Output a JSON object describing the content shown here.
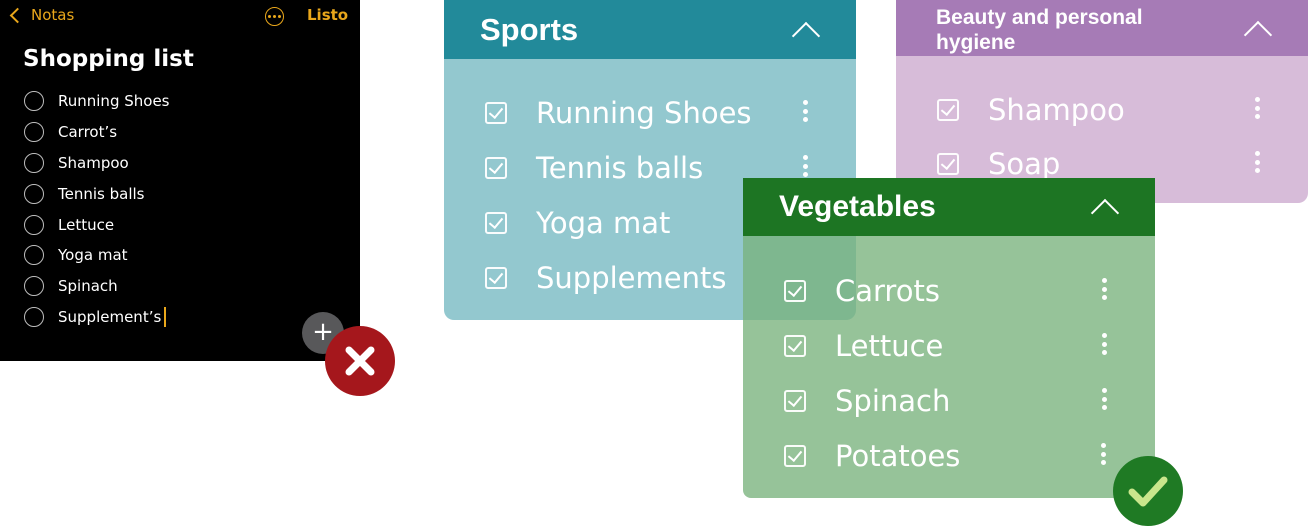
{
  "notes_app": {
    "back_label": "Notas",
    "done_label": "Listo",
    "title": "Shopping list",
    "items": [
      {
        "label": "Running Shoes"
      },
      {
        "label": "Carrot’s"
      },
      {
        "label": "Shampoo"
      },
      {
        "label": "Tennis balls"
      },
      {
        "label": "Lettuce"
      },
      {
        "label": "Yoga mat"
      },
      {
        "label": "Spinach"
      },
      {
        "label": "Supplement’s"
      }
    ],
    "add_icon": "plus-icon",
    "accent_color": "#e9a71b"
  },
  "badges": {
    "wrong": {
      "icon": "cross-icon",
      "color": "#a5171c"
    },
    "right": {
      "icon": "checkmark-icon",
      "color": "#1f7a24"
    }
  },
  "categories": {
    "sports": {
      "title": "Sports",
      "header_color": "#228a9a",
      "body_color": "#93c8cf",
      "items": [
        {
          "label": "Running Shoes",
          "checked": true
        },
        {
          "label": "Tennis balls",
          "checked": true
        },
        {
          "label": "Yoga mat",
          "checked": true
        },
        {
          "label": "Supplements",
          "checked": true
        }
      ]
    },
    "beauty": {
      "title": "Beauty and personal hygiene",
      "header_color": "#a67bb6",
      "body_color": "#d7bcd9",
      "items": [
        {
          "label": "Shampoo",
          "checked": true
        },
        {
          "label": "Soap",
          "checked": true
        }
      ]
    },
    "vegetables": {
      "title": "Vegetables",
      "header_color": "#1d7523",
      "body_color": "#79b27c",
      "items": [
        {
          "label": "Carrots",
          "checked": true
        },
        {
          "label": "Lettuce",
          "checked": true
        },
        {
          "label": "Spinach",
          "checked": true
        },
        {
          "label": "Potatoes",
          "checked": true
        }
      ]
    }
  }
}
